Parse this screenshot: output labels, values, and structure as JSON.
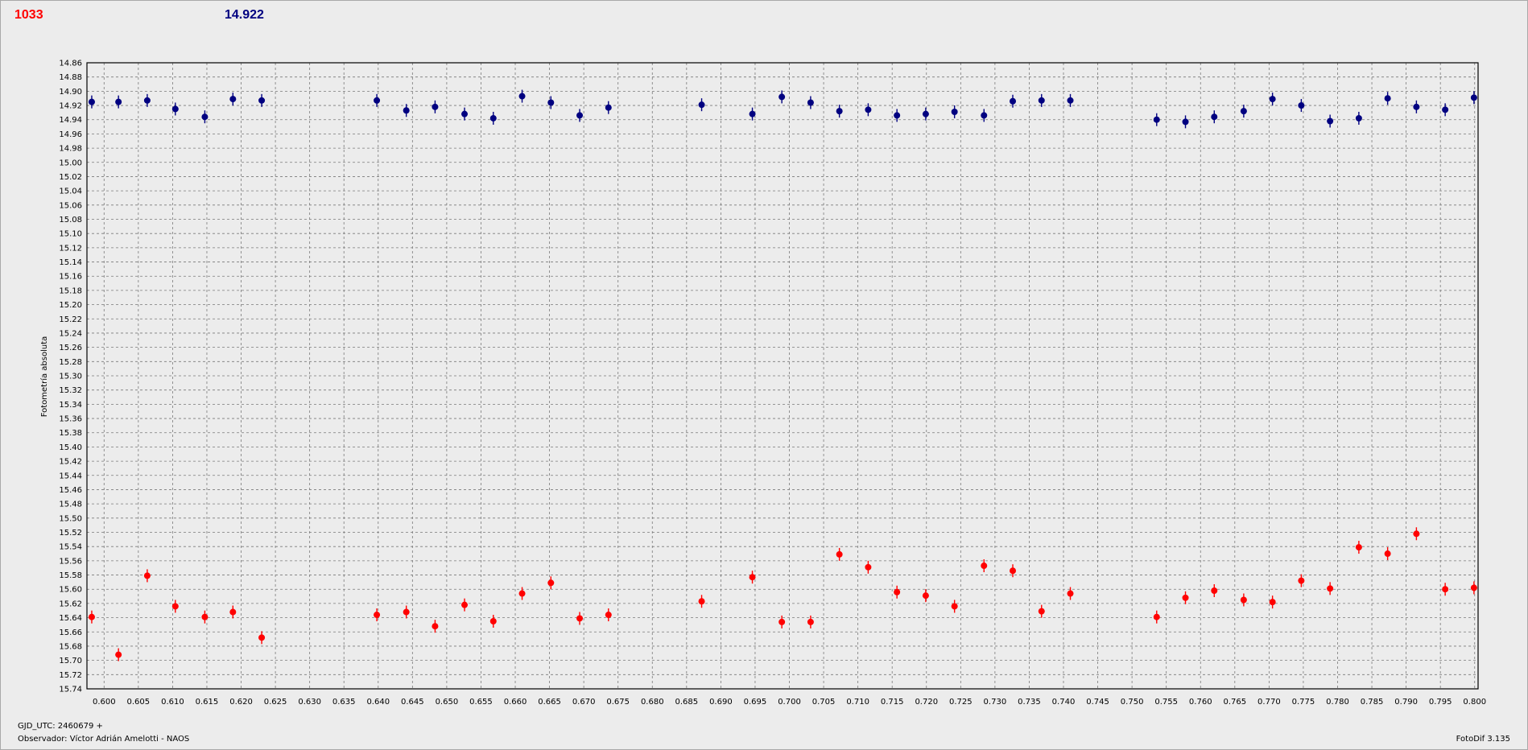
{
  "header": {
    "left_value": "1033",
    "right_value": "14.922"
  },
  "footer": {
    "gjd": "GJD_UTC: 2460679 +",
    "observer": "Observador: Víctor Adrián Amelotti - NAOS",
    "version": "FotoDif 3.135"
  },
  "colors": {
    "series_target": "#ff0000",
    "series_comparison": "#000080",
    "grid": "#7a7a7a",
    "background": "#ececec"
  },
  "chart_data": {
    "type": "scatter",
    "ylabel": "Fotometría absoluta",
    "xlabel": "",
    "xlim": [
      0.5975,
      0.8005
    ],
    "ylim": [
      14.86,
      15.74
    ],
    "y_inverted": true,
    "grid": true,
    "error_bars": true,
    "x_ticks": [
      "0.600",
      "0.605",
      "0.610",
      "0.615",
      "0.620",
      "0.625",
      "0.630",
      "0.635",
      "0.640",
      "0.645",
      "0.650",
      "0.655",
      "0.660",
      "0.665",
      "0.670",
      "0.675",
      "0.680",
      "0.685",
      "0.690",
      "0.695",
      "0.700",
      "0.705",
      "0.710",
      "0.715",
      "0.720",
      "0.725",
      "0.730",
      "0.735",
      "0.740",
      "0.745",
      "0.750",
      "0.755",
      "0.760",
      "0.765",
      "0.770",
      "0.775",
      "0.780",
      "0.785",
      "0.790",
      "0.795",
      "0.800"
    ],
    "y_ticks": [
      "14.86",
      "14.88",
      "14.90",
      "14.92",
      "14.94",
      "14.96",
      "14.98",
      "15.00",
      "15.02",
      "15.04",
      "15.06",
      "15.08",
      "15.10",
      "15.12",
      "15.14",
      "15.16",
      "15.18",
      "15.20",
      "15.22",
      "15.24",
      "15.26",
      "15.28",
      "15.30",
      "15.32",
      "15.34",
      "15.36",
      "15.38",
      "15.40",
      "15.42",
      "15.44",
      "15.46",
      "15.48",
      "15.50",
      "15.52",
      "15.54",
      "15.56",
      "15.58",
      "15.60",
      "15.62",
      "15.64",
      "15.66",
      "15.68",
      "15.70",
      "15.72",
      "15.74"
    ],
    "series": [
      {
        "color": "#000080",
        "points": [
          [
            0.5982,
            14.915
          ],
          [
            0.6021,
            14.915
          ],
          [
            0.6063,
            14.913
          ],
          [
            0.6104,
            14.925
          ],
          [
            0.6147,
            14.936
          ],
          [
            0.6188,
            14.911
          ],
          [
            0.623,
            14.913
          ],
          [
            0.6398,
            14.913
          ],
          [
            0.6441,
            14.927
          ],
          [
            0.6483,
            14.922
          ],
          [
            0.6526,
            14.932
          ],
          [
            0.6568,
            14.938
          ],
          [
            0.661,
            14.907
          ],
          [
            0.6652,
            14.916
          ],
          [
            0.6694,
            14.934
          ],
          [
            0.6736,
            14.923
          ],
          [
            0.6872,
            14.919
          ],
          [
            0.6946,
            14.932
          ],
          [
            0.6989,
            14.908
          ],
          [
            0.7031,
            14.916
          ],
          [
            0.7073,
            14.928
          ],
          [
            0.7115,
            14.926
          ],
          [
            0.7157,
            14.934
          ],
          [
            0.7199,
            14.932
          ],
          [
            0.7241,
            14.929
          ],
          [
            0.7284,
            14.934
          ],
          [
            0.7326,
            14.914
          ],
          [
            0.7368,
            14.913
          ],
          [
            0.741,
            14.913
          ],
          [
            0.7536,
            14.94
          ],
          [
            0.7578,
            14.943
          ],
          [
            0.762,
            14.936
          ],
          [
            0.7663,
            14.928
          ],
          [
            0.7705,
            14.911
          ],
          [
            0.7747,
            14.92
          ],
          [
            0.7789,
            14.942
          ],
          [
            0.7831,
            14.938
          ],
          [
            0.7873,
            14.91
          ],
          [
            0.7915,
            14.922
          ],
          [
            0.7957,
            14.926
          ],
          [
            0.7999,
            14.909
          ]
        ]
      },
      {
        "color": "#ff0000",
        "points": [
          [
            0.5982,
            15.639
          ],
          [
            0.6021,
            15.692
          ],
          [
            0.6063,
            15.581
          ],
          [
            0.6104,
            15.624
          ],
          [
            0.6147,
            15.639
          ],
          [
            0.6188,
            15.632
          ],
          [
            0.623,
            15.668
          ],
          [
            0.6398,
            15.636
          ],
          [
            0.6441,
            15.632
          ],
          [
            0.6483,
            15.652
          ],
          [
            0.6526,
            15.622
          ],
          [
            0.6568,
            15.645
          ],
          [
            0.661,
            15.606
          ],
          [
            0.6652,
            15.591
          ],
          [
            0.6694,
            15.641
          ],
          [
            0.6736,
            15.636
          ],
          [
            0.6872,
            15.617
          ],
          [
            0.6946,
            15.583
          ],
          [
            0.6989,
            15.646
          ],
          [
            0.7031,
            15.646
          ],
          [
            0.7073,
            15.551
          ],
          [
            0.7115,
            15.569
          ],
          [
            0.7157,
            15.604
          ],
          [
            0.7199,
            15.609
          ],
          [
            0.7241,
            15.624
          ],
          [
            0.7284,
            15.567
          ],
          [
            0.7326,
            15.574
          ],
          [
            0.7368,
            15.631
          ],
          [
            0.741,
            15.606
          ],
          [
            0.7536,
            15.639
          ],
          [
            0.7578,
            15.612
          ],
          [
            0.762,
            15.602
          ],
          [
            0.7663,
            15.615
          ],
          [
            0.7705,
            15.618
          ],
          [
            0.7747,
            15.588
          ],
          [
            0.7789,
            15.599
          ],
          [
            0.7831,
            15.541
          ],
          [
            0.7873,
            15.55
          ],
          [
            0.7915,
            15.522
          ],
          [
            0.7957,
            15.6
          ],
          [
            0.7999,
            15.598
          ]
        ]
      }
    ]
  }
}
